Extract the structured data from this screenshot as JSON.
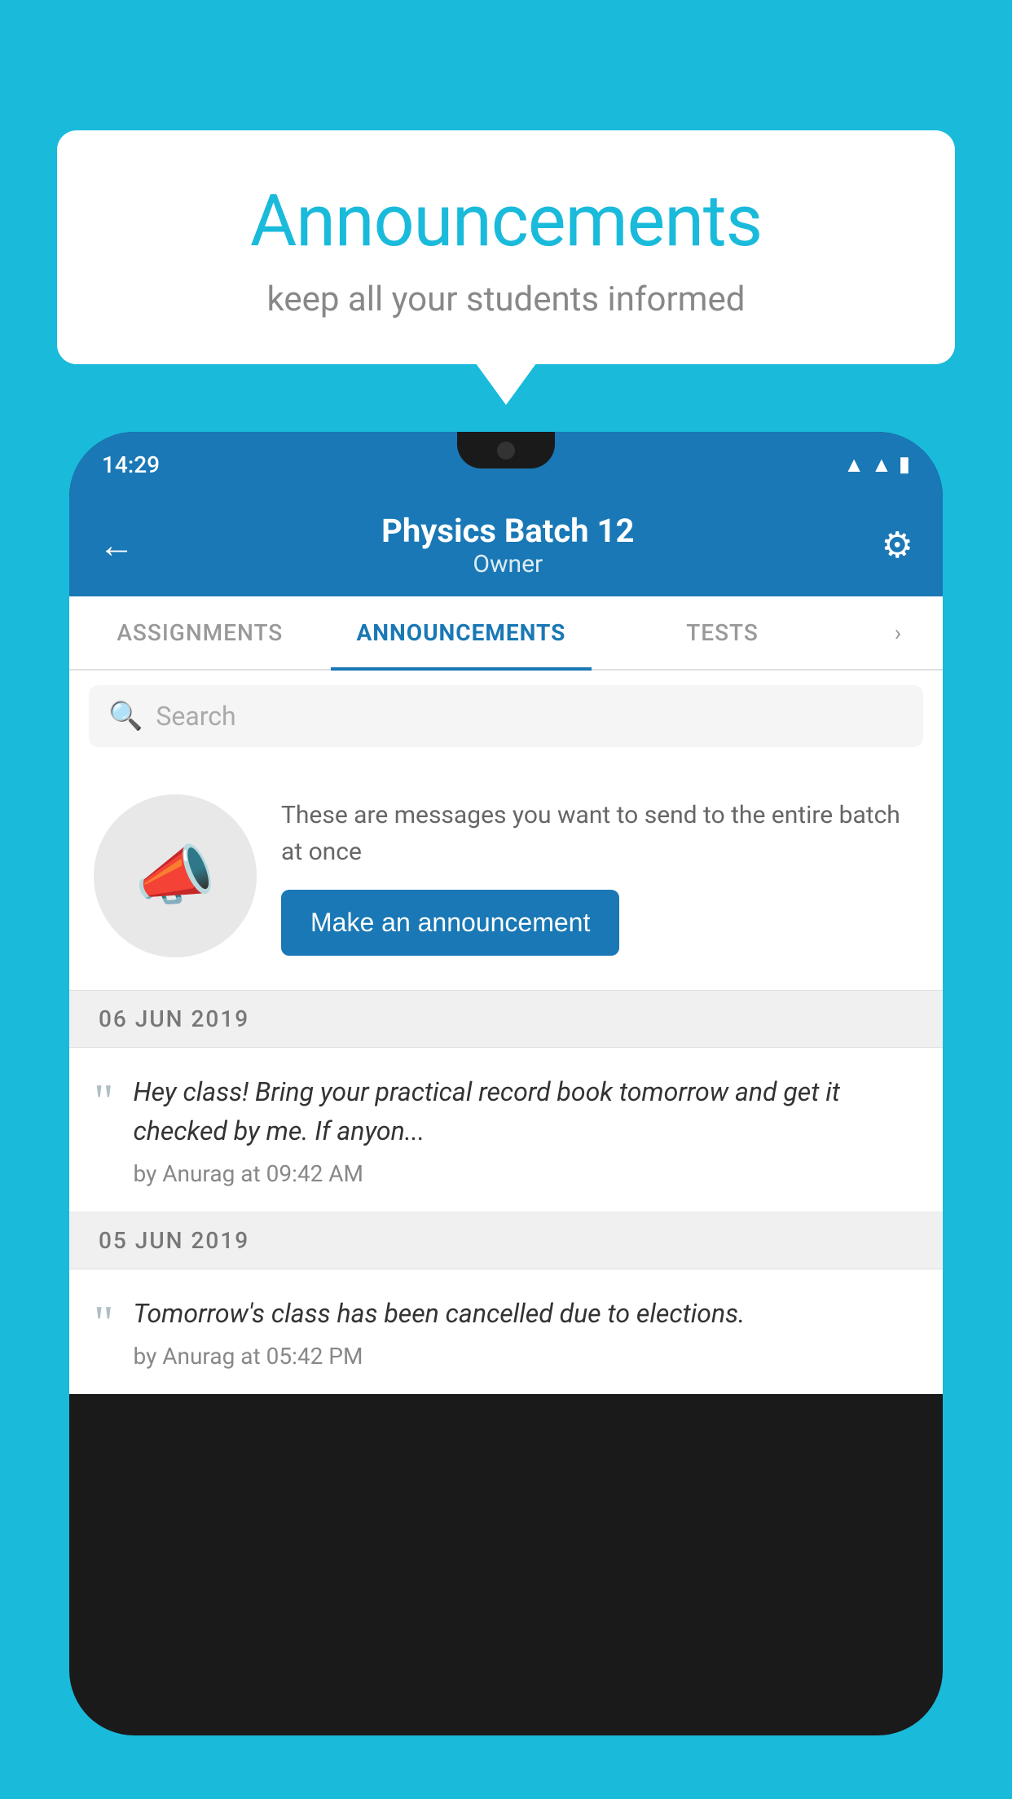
{
  "background": {
    "color": "#1ABADB"
  },
  "speech_bubble": {
    "title": "Announcements",
    "subtitle": "keep all your students informed"
  },
  "phone": {
    "status_bar": {
      "time": "14:29"
    },
    "app_bar": {
      "back_label": "←",
      "title": "Physics Batch 12",
      "subtitle": "Owner",
      "gear_label": "⚙"
    },
    "tabs": [
      {
        "label": "ASSIGNMENTS",
        "active": false
      },
      {
        "label": "ANNOUNCEMENTS",
        "active": true
      },
      {
        "label": "TESTS",
        "active": false
      }
    ],
    "search": {
      "placeholder": "Search"
    },
    "announcement_prompt": {
      "description": "These are messages you want to send to the entire batch at once",
      "button_label": "Make an announcement"
    },
    "announcements": [
      {
        "date": "06  JUN  2019",
        "text": "Hey class! Bring your practical record book tomorrow and get it checked by me. If anyon...",
        "meta": "by Anurag at 09:42 AM"
      },
      {
        "date": "05  JUN  2019",
        "text": "Tomorrow's class has been cancelled due to elections.",
        "meta": "by Anurag at 05:42 PM"
      }
    ]
  }
}
